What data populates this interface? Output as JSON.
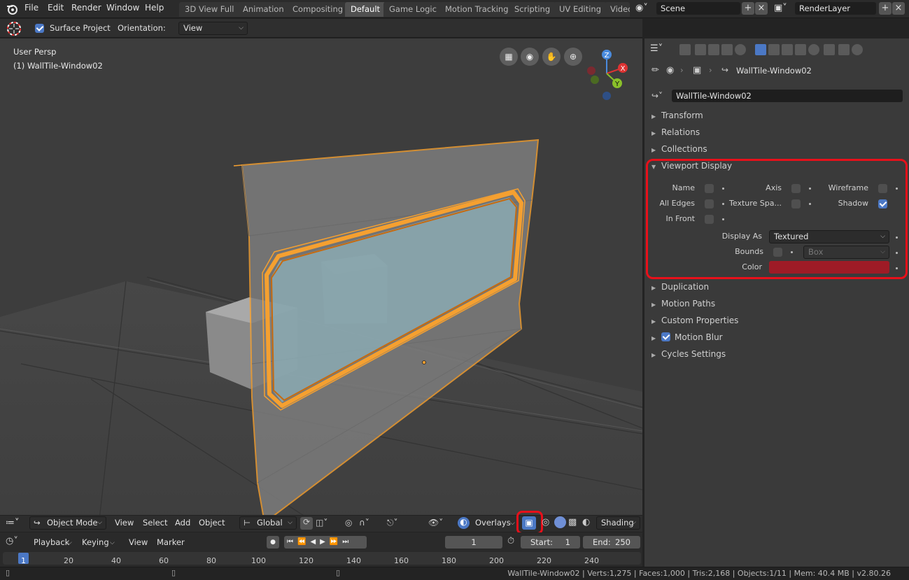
{
  "topbar": {
    "menus": [
      "File",
      "Edit",
      "Render",
      "Window",
      "Help"
    ],
    "workspaces": [
      "3D View Full",
      "Animation",
      "Compositing",
      "Default",
      "Game Logic",
      "Motion Tracking",
      "Scripting",
      "UV Editing",
      "Video"
    ],
    "active_workspace": "Default",
    "scene": "Scene",
    "render_layer": "RenderLayer"
  },
  "tool_header": {
    "surface_project_label": "Surface Project",
    "surface_project_checked": true,
    "orientation_label": "Orientation:",
    "orientation_value": "View"
  },
  "viewport": {
    "perspective": "User Persp",
    "object_info": "(1) WallTile-Window02"
  },
  "viewport_header": {
    "mode": "Object Mode",
    "menus": [
      "View",
      "Select",
      "Add",
      "Object"
    ],
    "transform_orientation": "Global",
    "overlays_label": "Overlays",
    "shading_label": "Shading"
  },
  "timeline": {
    "menus": [
      "Playback",
      "Keying",
      "View",
      "Marker"
    ],
    "current_frame": "1",
    "start_label": "Start:",
    "start_value": "1",
    "end_label": "End:",
    "end_value": "250",
    "ruler": [
      "1",
      "20",
      "40",
      "60",
      "80",
      "100",
      "120",
      "140",
      "160",
      "180",
      "200",
      "220",
      "240"
    ]
  },
  "properties": {
    "breadcrumb_object": "WallTile-Window02",
    "object_name": "WallTile-Window02",
    "sections_before": [
      "Transform",
      "Relations",
      "Collections"
    ],
    "viewport_display": {
      "title": "Viewport Display",
      "name_label": "Name",
      "axis_label": "Axis",
      "wireframe_label": "Wireframe",
      "all_edges_label": "All Edges",
      "texture_space_label": "Texture Spa...",
      "shadow_label": "Shadow",
      "in_front_label": "In Front",
      "display_as_label": "Display As",
      "display_as_value": "Textured",
      "bounds_label": "Bounds",
      "bounds_value": "Box",
      "color_label": "Color",
      "color_value": "#9e1b26"
    },
    "sections_after": [
      "Duplication",
      "Motion Paths",
      "Custom Properties",
      "Motion Blur",
      "Cycles Settings"
    ]
  },
  "status_bar": {
    "text": "WallTile-Window02 | Verts:1,275 | Faces:1,000 | Tris:2,168 | Objects:1/11 | Mem: 40.4 MB | v2.80.26"
  },
  "colors": {
    "selection_orange": "#f5a030",
    "highlight_red": "#e8101a",
    "accent_blue": "#4b78c5"
  }
}
